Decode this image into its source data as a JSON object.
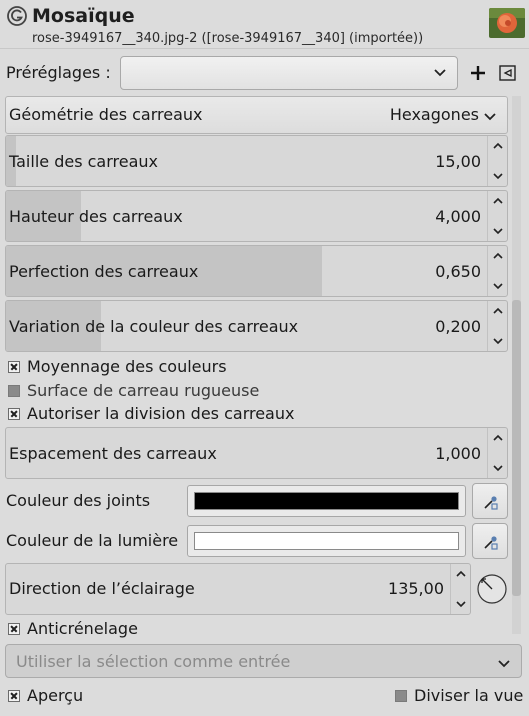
{
  "header": {
    "title": "Mosaïque",
    "subtitle": "rose-3949167__340.jpg-2 ([rose-3949167__340] (importée))",
    "icon": "gimp-icon",
    "thumbnail": "rose-image-thumbnail"
  },
  "presets": {
    "label": "Préréglages :",
    "value": "",
    "add_icon": "plus-icon",
    "menu_icon": "triangle-left-menu-icon"
  },
  "geometry": {
    "label": "Géométrie des carreaux",
    "value": "Hexagones"
  },
  "sliders": [
    {
      "label": "Taille des carreaux",
      "value": "15,00",
      "fill": 0.02
    },
    {
      "label": "Hauteur des carreaux",
      "value": "4,000",
      "fill": 0.15
    },
    {
      "label": "Perfection des carreaux",
      "value": "0,650",
      "fill": 0.63
    },
    {
      "label": "Variation de la couleur des carreaux",
      "value": "0,200",
      "fill": 0.19
    }
  ],
  "checks": {
    "color_averaging": {
      "label": "Moyennage des couleurs",
      "checked": true
    },
    "rough_surface": {
      "label": "Surface de carreau rugueuse",
      "checked": false
    },
    "allow_split": {
      "label": "Autoriser la division des carreaux",
      "checked": true
    },
    "antialiasing": {
      "label": "Anticrénelage",
      "checked": true
    },
    "preview": {
      "label": "Aperçu",
      "checked": true
    },
    "split_view": {
      "label": "Diviser la vue",
      "checked": false
    }
  },
  "spacing": {
    "label": "Espacement des carreaux",
    "value": "1,000",
    "fill": 0.0
  },
  "joint_color": {
    "label": "Couleur des joints",
    "color": "#000000"
  },
  "light_color": {
    "label": "Couleur de la lumière",
    "color": "#ffffff"
  },
  "light_direction": {
    "label": "Direction de l’éclairage",
    "value": "135,00",
    "fill": 0.0
  },
  "use_selection": {
    "label": "Utiliser la sélection comme entrée"
  },
  "colors": {
    "background": "#dcdcdc",
    "slider_fill": "#c4c4c4",
    "panel": "#d8d8d8"
  }
}
